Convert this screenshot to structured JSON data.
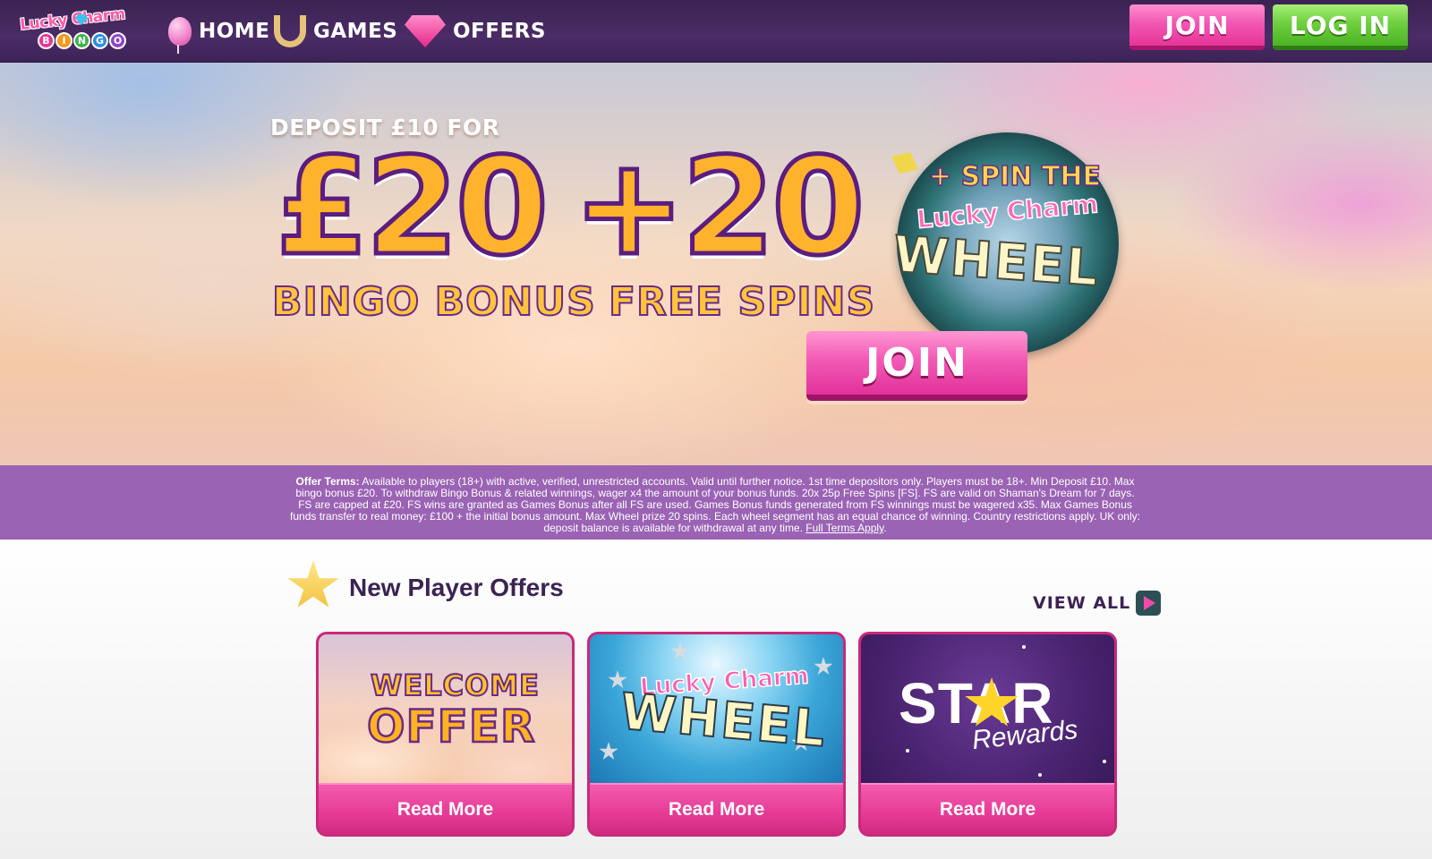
{
  "brand": {
    "logo_line1": "Lucky Charm",
    "logo_line2": [
      "B",
      "I",
      "N",
      "G",
      "O"
    ],
    "ball_colors": [
      "#e63598",
      "#f29a1f",
      "#3fb24a",
      "#2d8fe0",
      "#8e44c4"
    ]
  },
  "nav": {
    "home": "HOME",
    "games": "GAMES",
    "offers": "OFFERS"
  },
  "header_buttons": {
    "join": "JOIN",
    "login": "LOG IN"
  },
  "hero": {
    "deposit_text": "DEPOSIT £10 FOR",
    "bonus_amount": "£20",
    "bonus_label": "BINGO BONUS",
    "spins_amount": "+20",
    "spins_label": "FREE SPINS",
    "wheel_line1": "+ SPIN THE",
    "wheel_line2": "Lucky Charm",
    "wheel_line3": "WHEEL",
    "join_button": "JOIN"
  },
  "terms": {
    "label": "Offer Terms:",
    "text": " Available to players (18+) with active, verified, unrestricted accounts. Valid until further notice. 1st time depositors only. Players must be 18+. Min Deposit £10. Max bingo bonus £20. To withdraw Bingo Bonus & related winnings, wager x4 the amount of your bonus funds. 20x 25p Free Spins [FS]. FS are valid on Shaman's Dream for 7 days. FS are capped at £20. FS wins are granted as Games Bonus after all FS are used. Games Bonus funds generated from FS winnings must be wagered x35. Max Games Bonus funds transfer to real money: £100 + the initial bonus amount. Max Wheel prize 20 spins. Each wheel segment has an equal chance of winning. Country restrictions apply. UK only: deposit balance is available for withdrawal at any time. ",
    "link": "Full Terms Apply",
    "end": "."
  },
  "offers_section": {
    "title": "New Player Offers",
    "view_all": "VIEW ALL",
    "cards": [
      {
        "image_line1": "WELCOME",
        "image_line2": "OFFER",
        "button": "Read More"
      },
      {
        "image_line1": "Lucky Charm",
        "image_line2": "WHEEL",
        "button": "Read More"
      },
      {
        "image_line1": "STAR",
        "image_line2": "Rewards",
        "button": "Read More"
      }
    ]
  },
  "icons": {
    "home": "balloon-icon",
    "games": "horseshoe-icon",
    "offers": "diamond-icon",
    "section": "star-icon",
    "view_all": "play-icon"
  },
  "colors": {
    "header_bg": "#4b2c66",
    "join_pink": "#f257b4",
    "login_green": "#6fcf3f",
    "terms_bg": "#9a63b4",
    "title_purple": "#3b2353"
  }
}
